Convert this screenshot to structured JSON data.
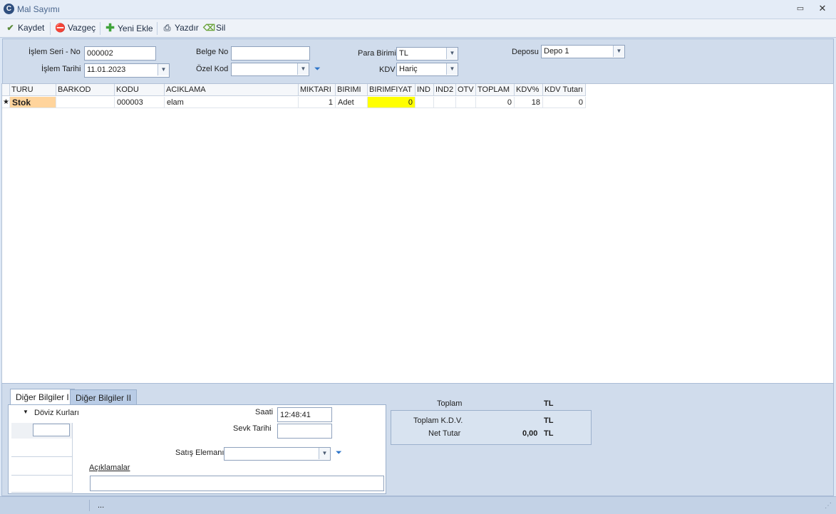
{
  "window": {
    "title": "Mal Sayımı",
    "app_icon": "C"
  },
  "toolbar": {
    "kaydet": "Kaydet",
    "vazgec": "Vazgeç",
    "yeni_ekle": "Yeni Ekle",
    "yazdir": "Yazdır",
    "sil": "Sil"
  },
  "header": {
    "islem_seri_no_label": "İşlem  Seri - No",
    "islem_seri_no_value": "000002",
    "islem_tarihi_label": "İşlem Tarihi",
    "islem_tarihi_value": "11.01.2023",
    "belge_no_label": "Belge No",
    "belge_no_value": "",
    "ozel_kod_label": "Özel Kod",
    "ozel_kod_value": "",
    "para_birimi_label": "Para Birimi",
    "para_birimi_value": "TL",
    "kdv_label": "KDV",
    "kdv_value": "Hariç",
    "deposu_label": "Deposu",
    "deposu_value": "Depo 1"
  },
  "grid": {
    "columns": [
      "TURU",
      "BARKOD",
      "KODU",
      "ACIKLAMA",
      "MIKTARI",
      "BIRIMI",
      "BIRIMFIYAT",
      "IND",
      "IND2",
      "OTV",
      "TOPLAM",
      "KDV%",
      "KDV Tutarı"
    ],
    "rows": [
      {
        "marker": "★",
        "turu": "Stok",
        "barkod": "",
        "kodu": "000003",
        "aciklama": "elam",
        "miktari": "1",
        "birimi": "Adet",
        "birimfiyat": "0",
        "ind": "",
        "ind2": "",
        "otv": "",
        "toplam": "0",
        "kdv_pct": "18",
        "kdv_tutari": "0"
      }
    ]
  },
  "bottom": {
    "tab1": "Diğer Bilgiler I",
    "tab2": "Diğer Bilgiler II",
    "doviz_kurlari": "Döviz Kurları",
    "saati_label": "Saati",
    "saati_value": "12:48:41",
    "sevk_tarihi_label": "Sevk Tarihi",
    "sevk_tarihi_value": "",
    "satis_elemani_label": "Satış Elemanı",
    "satis_elemani_value": "",
    "aciklamalar_label": "Açıklamalar",
    "aciklamalar_value": ""
  },
  "totals": {
    "toplam_label": "Toplam",
    "toplam_currency": "TL",
    "toplam_kdv_label": "Toplam K.D.V.",
    "toplam_kdv_currency": "TL",
    "net_tutar_label": "Net Tutar",
    "net_tutar_value": "0,00",
    "net_tutar_currency": "TL"
  },
  "status": {
    "text": "..."
  },
  "colors": {
    "highlight_yellow": "#ffff00",
    "stok_cell": "#ffd49c"
  }
}
